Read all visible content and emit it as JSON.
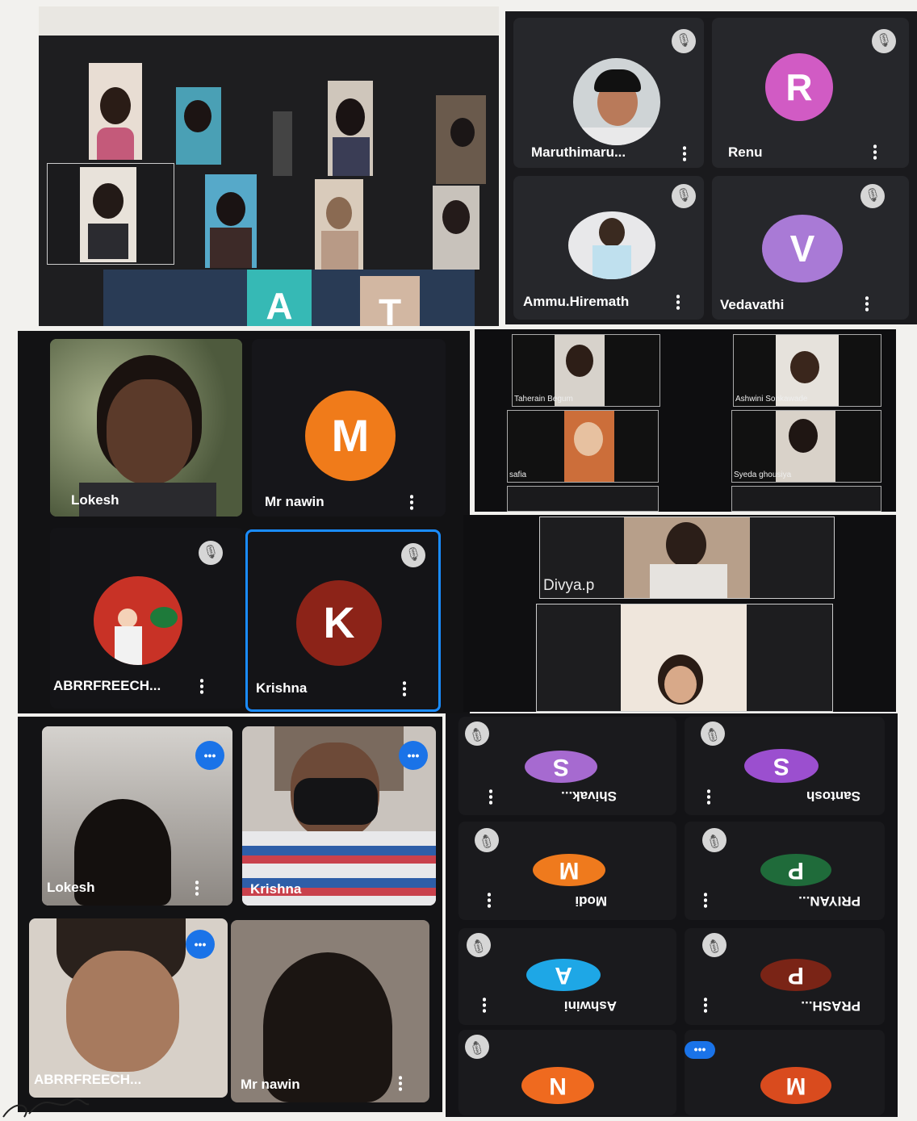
{
  "panel_top_left": {
    "letters": [
      "A",
      "T"
    ]
  },
  "panel_top_right": {
    "participants": [
      {
        "name": "Maruthimaru...",
        "avatar": "photo",
        "muted": true
      },
      {
        "name": "Renu",
        "avatar_letter": "R",
        "color": "#d15bc4",
        "muted": true
      },
      {
        "name": "Ammu.Hiremath",
        "avatar": "photo",
        "muted": true
      },
      {
        "name": "Vedavathi",
        "avatar_letter": "V",
        "color": "#a97ad6",
        "muted": true
      }
    ]
  },
  "panel_mid_left": {
    "participants": [
      {
        "name": "Lokesh",
        "avatar": "video"
      },
      {
        "name": "Mr nawin",
        "avatar_letter": "M",
        "color": "#f07b1a"
      },
      {
        "name": "ABRRFREECH...",
        "avatar": "photo",
        "muted": true
      },
      {
        "name": "Krishna",
        "avatar_letter": "K",
        "color": "#8c2318",
        "muted": true,
        "active": true
      }
    ]
  },
  "panel_mid_right_top": {
    "labels": [
      "Taherain Begum",
      "Ashwini Sonkawade",
      "safia",
      "Syeda ghousiya"
    ]
  },
  "panel_mid_right_bottom": {
    "labels": [
      "Divya.p"
    ]
  },
  "panel_bottom_left": {
    "participants": [
      {
        "name": "Lokesh",
        "speaking": true
      },
      {
        "name": "Krishna",
        "speaking": true
      },
      {
        "name": "ABRRFREECH...",
        "speaking": true
      },
      {
        "name": "Mr nawin"
      }
    ]
  },
  "panel_bottom_right": {
    "participants": [
      {
        "name": "Shivak...",
        "avatar_letter": "S",
        "color": "#a66ad0"
      },
      {
        "name": "Santosh",
        "avatar_letter": "S",
        "color": "#9b4fcf"
      },
      {
        "name": "Modi",
        "avatar_letter": "M",
        "color": "#ef7a1d"
      },
      {
        "name": "PRIYAN...",
        "avatar_letter": "P",
        "color": "#1f6b3a"
      },
      {
        "name": "Ashwini",
        "avatar_letter": "A",
        "color": "#1ea7e6"
      },
      {
        "name": "PRASH...",
        "avatar_letter": "P",
        "color": "#7a2416"
      },
      {
        "name": "",
        "avatar_letter": "N",
        "color": "#ef6a1f"
      },
      {
        "name": "",
        "avatar_letter": "M",
        "color": "#d94b1e"
      }
    ]
  }
}
